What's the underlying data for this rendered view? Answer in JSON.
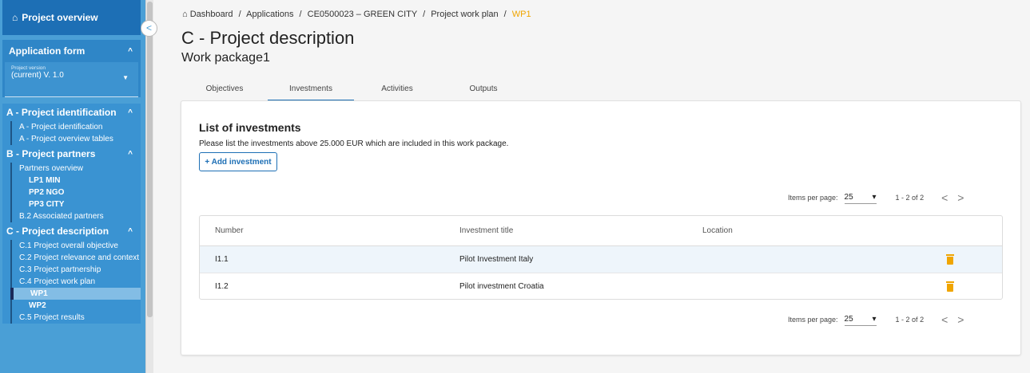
{
  "sidebar": {
    "top_label": "Project overview",
    "application_form": "Application form",
    "version_label": "Project version",
    "version_value": "(current) V. 1.0",
    "sections": {
      "a": {
        "title": "A - Project identification",
        "items": [
          "A - Project identification",
          "A - Project overview tables"
        ]
      },
      "b": {
        "title": "B - Project partners",
        "overview": "Partners overview",
        "partners": [
          "LP1 MIN",
          "PP2 NGO",
          "PP3 CITY"
        ],
        "associated": "B.2 Associated partners"
      },
      "c": {
        "title": "C - Project description",
        "items": [
          "C.1 Project overall objective",
          "C.2 Project relevance and context",
          "C.3 Project partnership",
          "C.4 Project work plan"
        ],
        "workpackages": [
          "WP1",
          "WP2"
        ],
        "next": "C.5 Project results"
      }
    }
  },
  "breadcrumb": [
    "Dashboard",
    "Applications",
    "CE0500023 – GREEN CITY",
    "Project work plan",
    "WP1"
  ],
  "page": {
    "title": "C - Project description",
    "subtitle": "Work package1"
  },
  "tabs": [
    "Objectives",
    "Investments",
    "Activities",
    "Outputs"
  ],
  "card": {
    "title": "List of investments",
    "description": "Please list the investments above 25.000 EUR which are included in this work package.",
    "add_button": "+ Add investment"
  },
  "pager": {
    "items_per_page_label": "Items per page:",
    "page_size": "25",
    "range": "1 - 2 of 2"
  },
  "table": {
    "headers": [
      "Number",
      "Investment title",
      "Location"
    ],
    "rows": [
      {
        "number": "I1.1",
        "title": "Pilot Investment Italy",
        "location": ""
      },
      {
        "number": "I1.2",
        "title": "Pilot investment Croatia",
        "location": ""
      }
    ]
  },
  "colors": {
    "accent": "#1d6fb5",
    "sidebar": "#4a9fd6",
    "current": "#f0a500",
    "delete": "#f0a500"
  }
}
